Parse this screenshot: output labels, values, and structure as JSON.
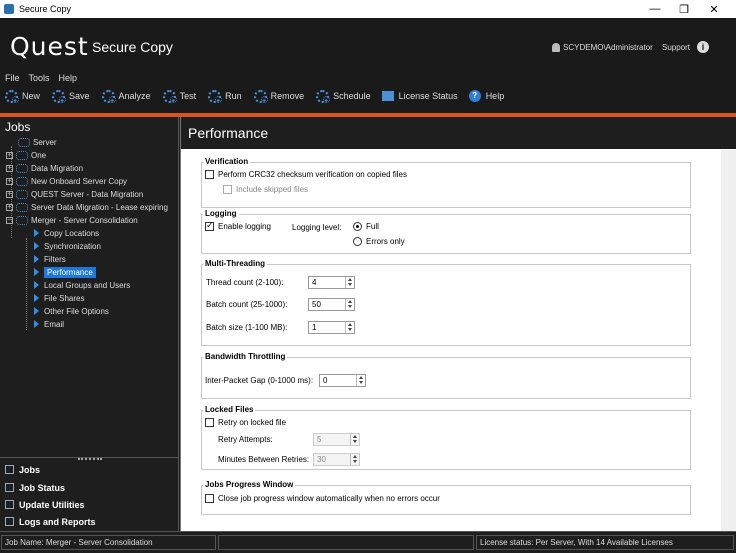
{
  "window": {
    "title": "Secure Copy",
    "minimize": "—",
    "restore": "❐",
    "close": "✕"
  },
  "header": {
    "logo": "Quest",
    "product": "Secure Copy",
    "user": "SCYDEMO\\Administrator",
    "support": "Support"
  },
  "menu": [
    "File",
    "Tools",
    "Help"
  ],
  "toolbar": {
    "new": "New",
    "save": "Save",
    "analyze": "Analyze",
    "test": "Test",
    "run": "Run",
    "remove": "Remove",
    "schedule": "Schedule",
    "license": "License Status",
    "help": "Help"
  },
  "jobs": {
    "title": "Jobs",
    "tree": [
      {
        "label": "Server",
        "level": 0
      },
      {
        "label": "One",
        "level": 0
      },
      {
        "label": "Data Migration",
        "level": 0
      },
      {
        "label": "New Onboard Server Copy",
        "level": 0
      },
      {
        "label": "QUEST Server - Data Migration",
        "level": 0
      },
      {
        "label": "Server Data Migration - Lease expiring",
        "level": 0
      },
      {
        "label": "Merger - Server Consolidation",
        "level": 0
      },
      {
        "label": "Copy Locations",
        "level": 1
      },
      {
        "label": "Synchronization",
        "level": 1
      },
      {
        "label": "Filters",
        "level": 1
      },
      {
        "label": "Performance",
        "level": 1
      },
      {
        "label": "Local Groups and Users",
        "level": 1
      },
      {
        "label": "File Shares",
        "level": 1
      },
      {
        "label": "Other File Options",
        "level": 1
      },
      {
        "label": "Email",
        "level": 1
      }
    ],
    "nav": [
      "Jobs",
      "Job Status",
      "Update Utilities",
      "Logs and Reports"
    ]
  },
  "main": {
    "title": "Performance",
    "verification": {
      "label": "Verification",
      "crc": "Perform CRC32 checksum verification on copied files",
      "skipped": "Include skipped files"
    },
    "logging": {
      "label": "Logging",
      "enable": "Enable logging",
      "level_label": "Logging level:",
      "full": "Full",
      "errors": "Errors only"
    },
    "multithreading": {
      "label": "Multi-Threading",
      "thread_label": "Thread count (2-100):",
      "thread_value": "4",
      "batch_label": "Batch count (25-1000):",
      "batch_value": "50",
      "size_label": "Batch size (1-100 MB):",
      "size_value": "1"
    },
    "bandwidth": {
      "label": "Bandwidth Throttling",
      "gap_label": "Inter-Packet Gap (0-1000 ms):",
      "gap_value": "0"
    },
    "locked": {
      "label": "Locked Files",
      "retry": "Retry on locked file",
      "attempts_label": "Retry Attempts:",
      "attempts_value": "5",
      "minutes_label": "Minutes Between Retries:",
      "minutes_value": "30"
    },
    "progress": {
      "label": "Jobs Progress Window",
      "close": "Close job progress window automatically when no errors occur"
    }
  },
  "status": {
    "job": "Job Name: Merger - Server Consolidation",
    "license": "License status: Per Server, With 14 Available Licenses"
  }
}
